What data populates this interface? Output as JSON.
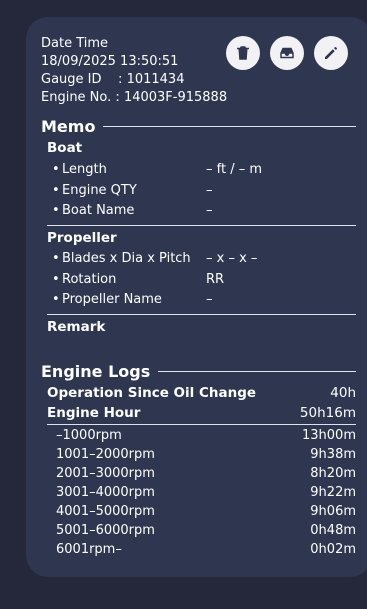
{
  "header": {
    "date_time_label": "Date Time",
    "date_time_value": "18/09/2025 13:50:51",
    "gauge_id_label": "Gauge ID",
    "gauge_id_value": "1011434",
    "engine_no_label": "Engine No.",
    "engine_no_value": "14003F-915888",
    "separator": ":"
  },
  "actions": {
    "icons": [
      "trash-icon",
      "upload-icon",
      "edit-pencil-icon"
    ]
  },
  "memo": {
    "title": "Memo",
    "boat": {
      "title": "Boat",
      "rows": [
        {
          "label": "Length",
          "value": "– ft / – m"
        },
        {
          "label": "Engine QTY",
          "value": "–"
        },
        {
          "label": "Boat Name",
          "value": "–"
        }
      ]
    },
    "propeller": {
      "title": "Propeller",
      "rows": [
        {
          "label": "Blades x Dia x Pitch",
          "value": "– x – x –"
        },
        {
          "label": "Rotation",
          "value": "RR"
        },
        {
          "label": "Propeller Name",
          "value": "–"
        }
      ]
    },
    "remark": {
      "title": "Remark"
    }
  },
  "engine_logs": {
    "title": "Engine Logs",
    "oil_change": {
      "label": "Operation Since Oil Change",
      "value": "40h"
    },
    "engine_hour": {
      "label": "Engine Hour",
      "value": "50h16m"
    },
    "rpm_rows": [
      {
        "label": "–1000rpm",
        "value": "13h00m"
      },
      {
        "label": "1001–2000rpm",
        "value": "9h38m"
      },
      {
        "label": "2001–3000rpm",
        "value": "8h20m"
      },
      {
        "label": "3001–4000rpm",
        "value": "9h22m"
      },
      {
        "label": "4001–5000rpm",
        "value": "9h06m"
      },
      {
        "label": "5001–6000rpm",
        "value": "0h48m"
      },
      {
        "label": "6001rpm–",
        "value": "0h02m"
      }
    ]
  },
  "bullet": "•"
}
